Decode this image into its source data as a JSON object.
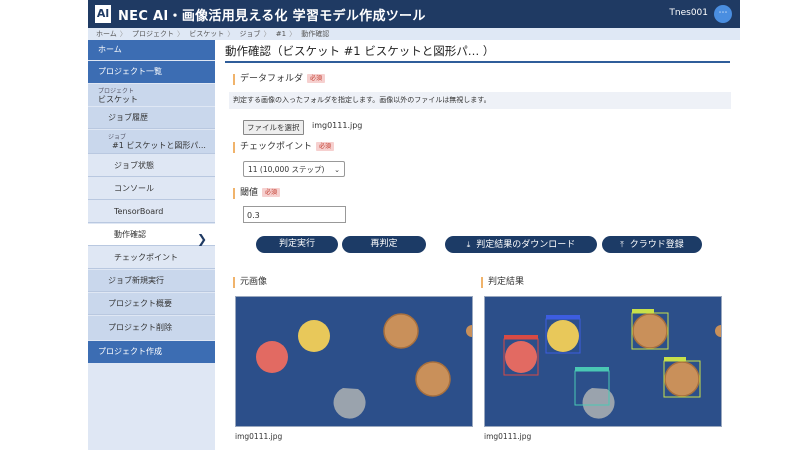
{
  "header": {
    "logo_text": "Al",
    "title": "NEC AI・画像活用見える化 学習モデル作成ツール",
    "user": "Tnes001",
    "user_menu_glyph": "⋯"
  },
  "breadcrumb": [
    "ホーム",
    "プロジェクト",
    "ビスケット",
    "ジョブ",
    "#1",
    "動作確認"
  ],
  "sidebar": {
    "home": "ホーム",
    "project_list": "プロジェクト一覧",
    "project_caption": "プロジェクト",
    "project_name": "ビスケット",
    "job_history": "ジョブ履歴",
    "job_caption": "ジョブ",
    "job_name": "#1 ビスケットと図形パ...",
    "job_status": "ジョブ状態",
    "console": "コンソール",
    "tensorboard": "TensorBoard",
    "verify": "動作確認",
    "checkpoint": "チェックポイント",
    "new_job": "ジョブ新規実行",
    "project_overview": "プロジェクト概要",
    "project_delete": "プロジェクト削除",
    "project_create": "プロジェクト作成"
  },
  "main": {
    "title": "動作確認（ビスケット #1 ビスケットと図形パ…  ）",
    "data_folder_label": "データフォルダ",
    "required": "必須",
    "hint": "判定する画像の入ったフォルダを指定します。画像以外のファイルは無視します。",
    "file_button": "ファイルを選択",
    "file_name": "img0111.jpg",
    "checkpoint_label": "チェックポイント",
    "checkpoint_value": "11 (10,000 ステップ)",
    "threshold_label": "閾値",
    "threshold_value": "0.3",
    "buttons": {
      "run": "判定実行",
      "rerun": "再判定",
      "download": "判定結果のダウンロード",
      "cloud": "クラウド登録"
    },
    "original_label": "元画像",
    "result_label": "判定結果",
    "original_caption": "img0111.jpg",
    "result_caption": "img0111.jpg"
  },
  "colors": {
    "header": "#1f3a63",
    "accent": "#3c6db3",
    "button": "#1c3b66",
    "image_bg": "#2c4f8a"
  }
}
